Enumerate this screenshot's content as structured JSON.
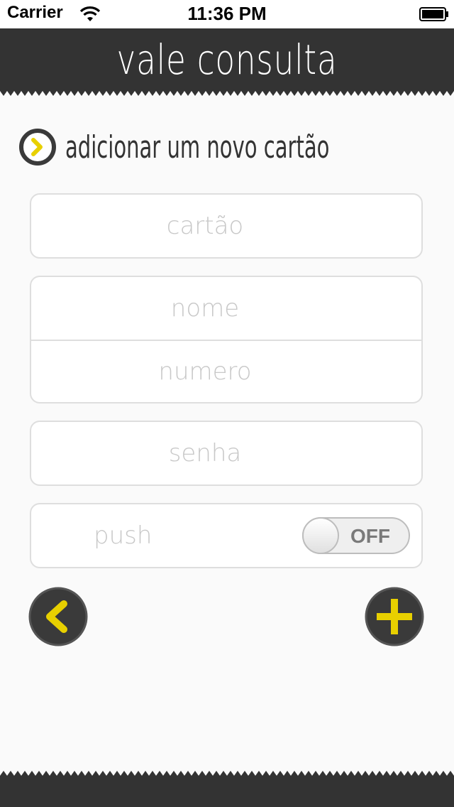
{
  "status_bar": {
    "carrier": "Carrier",
    "time": "11:36 PM",
    "wifi_icon": "wifi-icon",
    "battery_icon": "battery-icon"
  },
  "nav": {
    "title": "vale consulta"
  },
  "section": {
    "title": "adicionar um novo cartão",
    "icon": "chevron-right-circle-icon"
  },
  "form": {
    "card_placeholder": "cartão",
    "name_placeholder": "nome",
    "number_placeholder": "numero",
    "password_placeholder": "senha",
    "push_label": "push",
    "push_switch_label": "OFF",
    "push_enabled": false
  },
  "actions": {
    "back_icon": "chevron-left-icon",
    "add_icon": "plus-icon"
  },
  "colors": {
    "bar": "#333333",
    "accent": "#e8d000",
    "text_dark": "#333333",
    "placeholder": "#c8c8c8",
    "border": "#dedede"
  }
}
